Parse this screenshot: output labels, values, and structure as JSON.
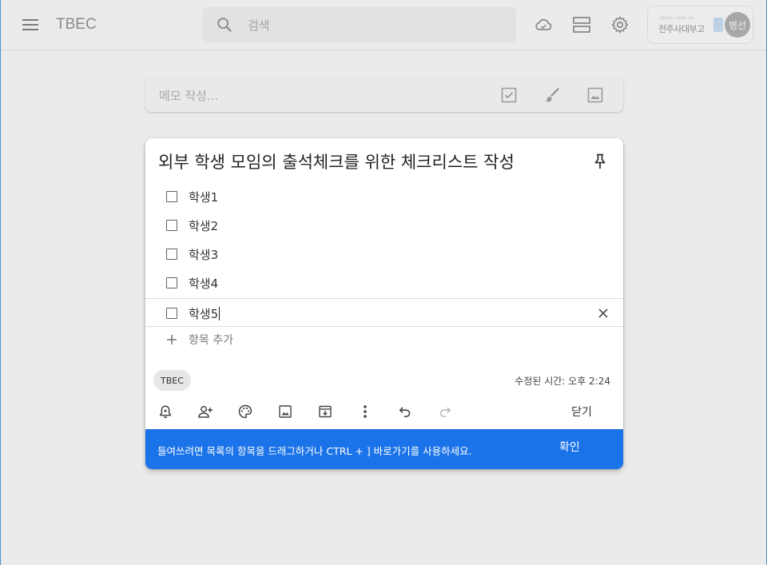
{
  "header": {
    "app_title": "TBEC",
    "search_placeholder": "검색",
    "org_name": "전주사대부고",
    "org_name_small": "전북대학교 사범대학 부설",
    "avatar_initials": "병선"
  },
  "take_note": {
    "placeholder": "메모 작성..."
  },
  "note": {
    "title": "외부 학생 모임의 출석체크를 위한 체크리스트 작성",
    "items": [
      "학생1",
      "학생2",
      "학생3",
      "학생4",
      "학생5"
    ],
    "add_item_label": "항목 추가",
    "label_chip": "TBEC",
    "edited_text": "수정된 시간: 오후 2:24",
    "close_label": "닫기"
  },
  "snackbar": {
    "message": "들여쓰려면 목록의 항목을 드래그하거나 CTRL + ] 바로가기를 사용하세요.",
    "action_label": "확인",
    "color": "#1a73e8"
  },
  "icons": {
    "header": [
      "menu-icon",
      "search-icon",
      "cloud-sync-icon",
      "list-view-icon",
      "settings-icon"
    ],
    "take_note": [
      "new-list-icon",
      "new-drawing-icon",
      "new-image-icon"
    ],
    "note_toolbar": [
      "remind-me-icon",
      "collaborator-icon",
      "palette-icon",
      "add-image-icon",
      "archive-icon",
      "more-icon",
      "undo-icon",
      "redo-icon"
    ]
  }
}
